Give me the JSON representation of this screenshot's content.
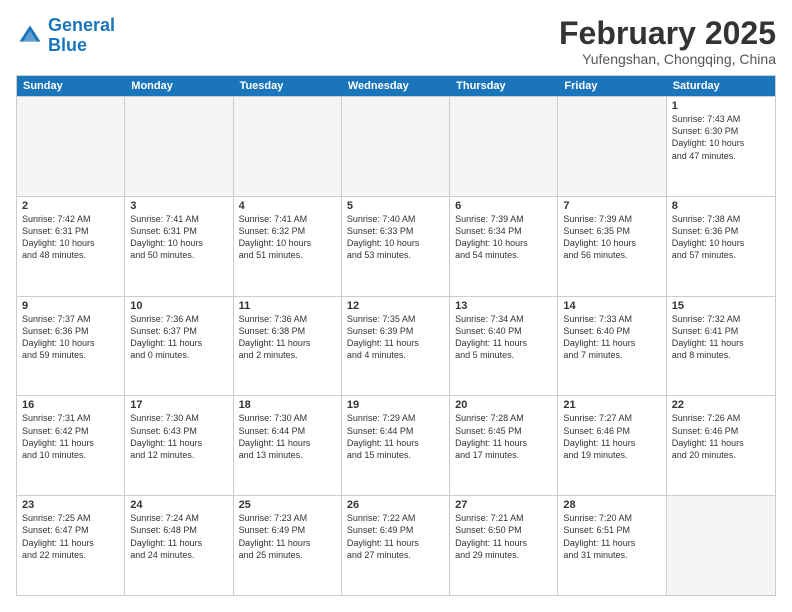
{
  "logo": {
    "line1": "General",
    "line2": "Blue"
  },
  "title": "February 2025",
  "location": "Yufengshan, Chongqing, China",
  "weekdays": [
    "Sunday",
    "Monday",
    "Tuesday",
    "Wednesday",
    "Thursday",
    "Friday",
    "Saturday"
  ],
  "rows": [
    [
      {
        "day": "",
        "text": ""
      },
      {
        "day": "",
        "text": ""
      },
      {
        "day": "",
        "text": ""
      },
      {
        "day": "",
        "text": ""
      },
      {
        "day": "",
        "text": ""
      },
      {
        "day": "",
        "text": ""
      },
      {
        "day": "1",
        "text": "Sunrise: 7:43 AM\nSunset: 6:30 PM\nDaylight: 10 hours\nand 47 minutes."
      }
    ],
    [
      {
        "day": "2",
        "text": "Sunrise: 7:42 AM\nSunset: 6:31 PM\nDaylight: 10 hours\nand 48 minutes."
      },
      {
        "day": "3",
        "text": "Sunrise: 7:41 AM\nSunset: 6:31 PM\nDaylight: 10 hours\nand 50 minutes."
      },
      {
        "day": "4",
        "text": "Sunrise: 7:41 AM\nSunset: 6:32 PM\nDaylight: 10 hours\nand 51 minutes."
      },
      {
        "day": "5",
        "text": "Sunrise: 7:40 AM\nSunset: 6:33 PM\nDaylight: 10 hours\nand 53 minutes."
      },
      {
        "day": "6",
        "text": "Sunrise: 7:39 AM\nSunset: 6:34 PM\nDaylight: 10 hours\nand 54 minutes."
      },
      {
        "day": "7",
        "text": "Sunrise: 7:39 AM\nSunset: 6:35 PM\nDaylight: 10 hours\nand 56 minutes."
      },
      {
        "day": "8",
        "text": "Sunrise: 7:38 AM\nSunset: 6:36 PM\nDaylight: 10 hours\nand 57 minutes."
      }
    ],
    [
      {
        "day": "9",
        "text": "Sunrise: 7:37 AM\nSunset: 6:36 PM\nDaylight: 10 hours\nand 59 minutes."
      },
      {
        "day": "10",
        "text": "Sunrise: 7:36 AM\nSunset: 6:37 PM\nDaylight: 11 hours\nand 0 minutes."
      },
      {
        "day": "11",
        "text": "Sunrise: 7:36 AM\nSunset: 6:38 PM\nDaylight: 11 hours\nand 2 minutes."
      },
      {
        "day": "12",
        "text": "Sunrise: 7:35 AM\nSunset: 6:39 PM\nDaylight: 11 hours\nand 4 minutes."
      },
      {
        "day": "13",
        "text": "Sunrise: 7:34 AM\nSunset: 6:40 PM\nDaylight: 11 hours\nand 5 minutes."
      },
      {
        "day": "14",
        "text": "Sunrise: 7:33 AM\nSunset: 6:40 PM\nDaylight: 11 hours\nand 7 minutes."
      },
      {
        "day": "15",
        "text": "Sunrise: 7:32 AM\nSunset: 6:41 PM\nDaylight: 11 hours\nand 8 minutes."
      }
    ],
    [
      {
        "day": "16",
        "text": "Sunrise: 7:31 AM\nSunset: 6:42 PM\nDaylight: 11 hours\nand 10 minutes."
      },
      {
        "day": "17",
        "text": "Sunrise: 7:30 AM\nSunset: 6:43 PM\nDaylight: 11 hours\nand 12 minutes."
      },
      {
        "day": "18",
        "text": "Sunrise: 7:30 AM\nSunset: 6:44 PM\nDaylight: 11 hours\nand 13 minutes."
      },
      {
        "day": "19",
        "text": "Sunrise: 7:29 AM\nSunset: 6:44 PM\nDaylight: 11 hours\nand 15 minutes."
      },
      {
        "day": "20",
        "text": "Sunrise: 7:28 AM\nSunset: 6:45 PM\nDaylight: 11 hours\nand 17 minutes."
      },
      {
        "day": "21",
        "text": "Sunrise: 7:27 AM\nSunset: 6:46 PM\nDaylight: 11 hours\nand 19 minutes."
      },
      {
        "day": "22",
        "text": "Sunrise: 7:26 AM\nSunset: 6:46 PM\nDaylight: 11 hours\nand 20 minutes."
      }
    ],
    [
      {
        "day": "23",
        "text": "Sunrise: 7:25 AM\nSunset: 6:47 PM\nDaylight: 11 hours\nand 22 minutes."
      },
      {
        "day": "24",
        "text": "Sunrise: 7:24 AM\nSunset: 6:48 PM\nDaylight: 11 hours\nand 24 minutes."
      },
      {
        "day": "25",
        "text": "Sunrise: 7:23 AM\nSunset: 6:49 PM\nDaylight: 11 hours\nand 25 minutes."
      },
      {
        "day": "26",
        "text": "Sunrise: 7:22 AM\nSunset: 6:49 PM\nDaylight: 11 hours\nand 27 minutes."
      },
      {
        "day": "27",
        "text": "Sunrise: 7:21 AM\nSunset: 6:50 PM\nDaylight: 11 hours\nand 29 minutes."
      },
      {
        "day": "28",
        "text": "Sunrise: 7:20 AM\nSunset: 6:51 PM\nDaylight: 11 hours\nand 31 minutes."
      },
      {
        "day": "",
        "text": ""
      }
    ]
  ]
}
